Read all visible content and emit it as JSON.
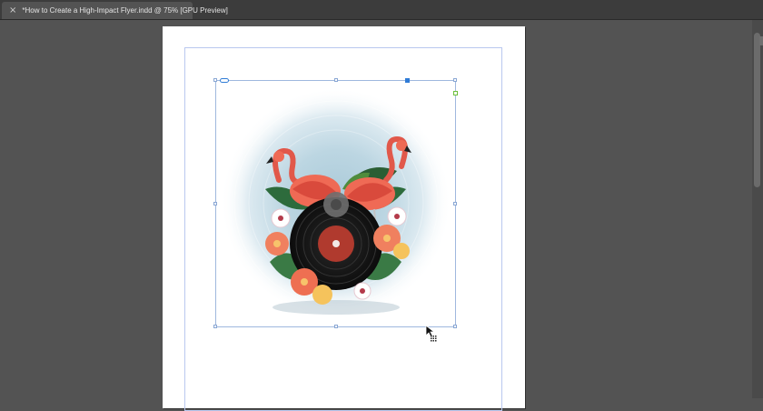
{
  "document_tab": {
    "title": "*How to Create a High-Impact Flyer.indd @ 75% [GPU Preview]",
    "close_glyph": "×"
  },
  "artwork": {
    "description_icon": "tropical-vinyl-flamingo-illustration"
  },
  "cursor": {
    "icon": "arrow-pointer-with-grid-icon"
  },
  "colors": {
    "pasteboard": "#535353",
    "page": "#ffffff",
    "selection": "#9fb8de",
    "accent_handle": "#2f7bd6",
    "content_grabber": "#6bbf3a"
  }
}
